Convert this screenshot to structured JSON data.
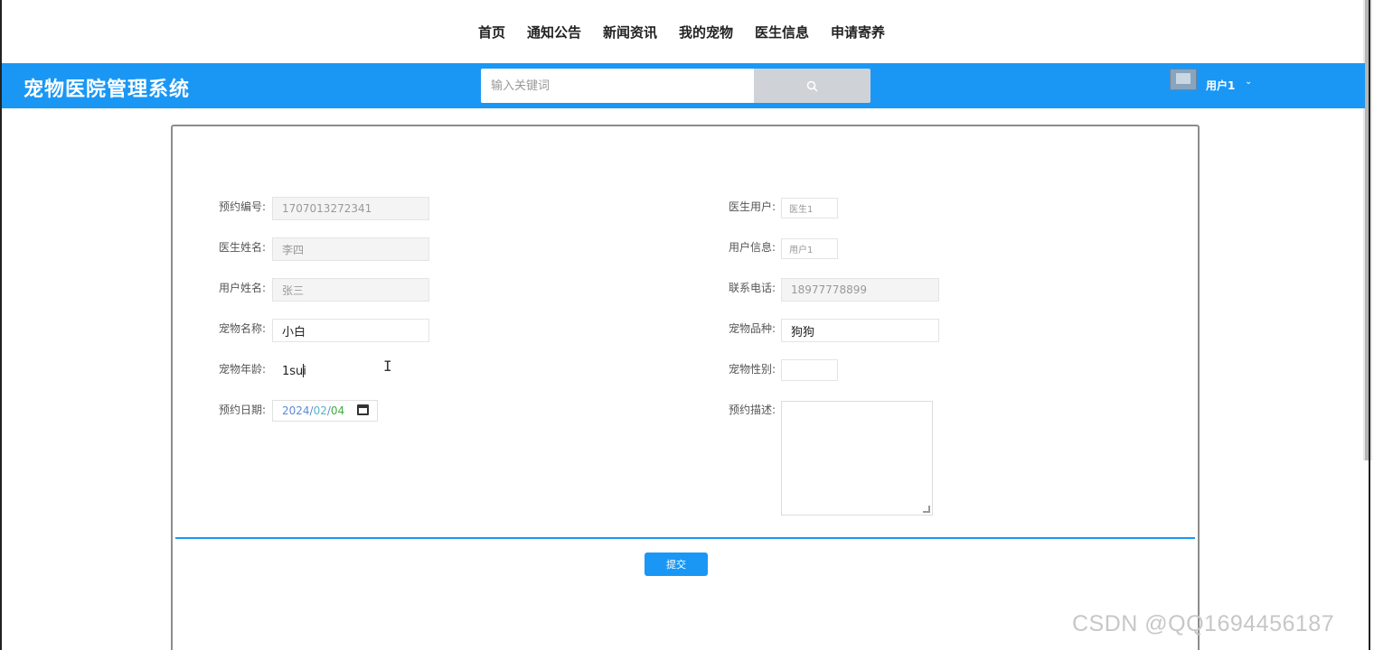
{
  "nav": {
    "items": [
      "首页",
      "通知公告",
      "新闻资讯",
      "我的宠物",
      "医生信息",
      "申请寄养"
    ]
  },
  "header": {
    "title": "宠物医院管理系统",
    "search_placeholder": "输入关键词",
    "username": "用户1",
    "caret": "⌄"
  },
  "form": {
    "left": [
      {
        "label": "预约编号:",
        "value": "1707013272341"
      },
      {
        "label": "医生姓名:",
        "value": "李四"
      },
      {
        "label": "用户姓名:",
        "value": "张三"
      },
      {
        "label": "宠物名称:",
        "value": "小白"
      },
      {
        "label": "宠物年龄:",
        "value": "1sui"
      },
      {
        "label": "预约日期:",
        "year": "2024",
        "month": "02",
        "day": "04"
      }
    ],
    "right": [
      {
        "label": "医生用户:",
        "value": "医生1"
      },
      {
        "label": "用户信息:",
        "value": "用户1"
      },
      {
        "label": "联系电话:",
        "value": "18977778899"
      },
      {
        "label": "宠物品种:",
        "value": "狗狗"
      },
      {
        "label": "宠物性别:",
        "value": ""
      },
      {
        "label": "预约描述:",
        "value": ""
      }
    ],
    "submit_label": "提交"
  },
  "watermark": "CSDN @QQ1694456187",
  "colors": {
    "primary": "#1a97f5"
  }
}
